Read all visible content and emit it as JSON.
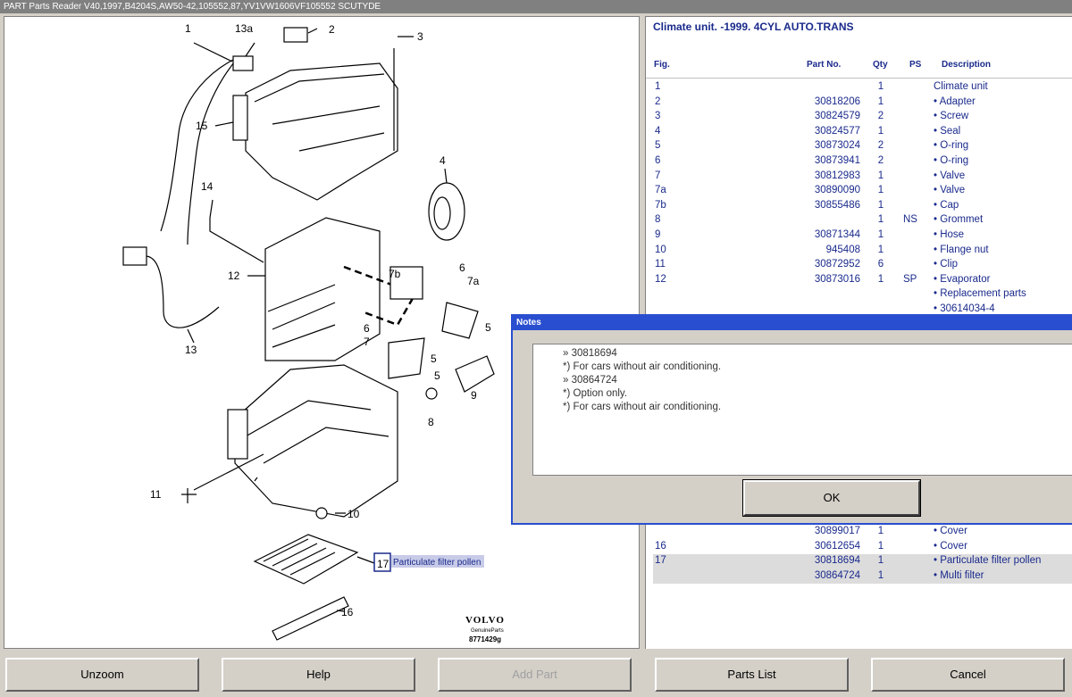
{
  "window": {
    "title": "PART Parts Reader V40,1997,B4204S,AW50-42,105552,87,YV1VW1606VF105552 SCUTYDE"
  },
  "diagram": {
    "callouts": {
      "c1": "1",
      "c13a": "13a",
      "c2": "2",
      "c3": "3",
      "c15": "15",
      "c4": "4",
      "c14": "14",
      "c12": "12",
      "c7b": "7b",
      "c6a": "6",
      "c7a": "7a",
      "c13": "13",
      "c6b": "6",
      "c7": "7",
      "c5a": "5",
      "c5b": "5",
      "c5c": "5",
      "c9": "9",
      "c8": "8",
      "c11": "11",
      "c10": "10",
      "c16": "16"
    },
    "selected_callout": "17",
    "selected_label": "Particulate filter pollen",
    "logo": {
      "brand": "VOLVO",
      "sub": "GenuineParts",
      "number": "8771429g"
    }
  },
  "parts": {
    "title": "Climate unit. -1999. 4CYL AUTO.TRANS",
    "headers": {
      "fig": "Fig.",
      "part_no": "Part No.",
      "qty": "Qty",
      "ps": "PS",
      "description": "Description"
    },
    "rows": [
      {
        "fig": "1",
        "part": "",
        "qty": "1",
        "ps": "",
        "desc": "Climate unit"
      },
      {
        "fig": "2",
        "part": "30818206",
        "qty": "1",
        "ps": "",
        "desc": "• Adapter"
      },
      {
        "fig": "3",
        "part": "30824579",
        "qty": "2",
        "ps": "",
        "desc": "• Screw"
      },
      {
        "fig": "4",
        "part": "30824577",
        "qty": "1",
        "ps": "",
        "desc": "• Seal"
      },
      {
        "fig": "5",
        "part": "30873024",
        "qty": "2",
        "ps": "",
        "desc": "• O-ring"
      },
      {
        "fig": "6",
        "part": "30873941",
        "qty": "2",
        "ps": "",
        "desc": "• O-ring"
      },
      {
        "fig": "7",
        "part": "30812983",
        "qty": "1",
        "ps": "",
        "desc": "• Valve"
      },
      {
        "fig": "7a",
        "part": "30890090",
        "qty": "1",
        "ps": "",
        "desc": "• Valve"
      },
      {
        "fig": "7b",
        "part": "30855486",
        "qty": "1",
        "ps": "",
        "desc": "• Cap"
      },
      {
        "fig": "8",
        "part": "",
        "qty": "1",
        "ps": "NS",
        "desc": "• Grommet"
      },
      {
        "fig": "9",
        "part": "30871344",
        "qty": "1",
        "ps": "",
        "desc": "• Hose"
      },
      {
        "fig": "10",
        "part": "945408",
        "qty": "1",
        "ps": "",
        "desc": "• Flange nut"
      },
      {
        "fig": "11",
        "part": "30872952",
        "qty": "6",
        "ps": "",
        "desc": "• Clip"
      },
      {
        "fig": "12",
        "part": "30873016",
        "qty": "1",
        "ps": "SP",
        "desc": "• Evaporator"
      },
      {
        "fig": "",
        "part": "",
        "qty": "",
        "ps": "",
        "desc": "• Replacement parts"
      },
      {
        "fig": "",
        "part": "",
        "qty": "",
        "ps": "",
        "desc": "• 30614034-4"
      }
    ],
    "rows_lower": [
      {
        "fig": "",
        "part": "30899017",
        "qty": "1",
        "ps": "",
        "desc": "• Cover"
      },
      {
        "fig": "16",
        "part": "30612654",
        "qty": "1",
        "ps": "",
        "desc": "• Cover"
      },
      {
        "fig": "17",
        "part": "30818694",
        "qty": "1",
        "ps": "",
        "desc": "• Particulate filter pollen"
      },
      {
        "fig": "",
        "part": "30864724",
        "qty": "1",
        "ps": "",
        "desc": "• Multi filter"
      }
    ]
  },
  "notes_dialog": {
    "title": "Notes",
    "lines": [
      "» 30818694",
      "*) For cars without air conditioning.",
      "» 30864724",
      "*) Option only.",
      "*) For cars without air conditioning."
    ],
    "ok_label": "OK"
  },
  "buttons": {
    "unzoom": "Unzoom",
    "help": "Help",
    "add_part": "Add Part",
    "parts_list": "Parts List",
    "cancel": "Cancel"
  }
}
